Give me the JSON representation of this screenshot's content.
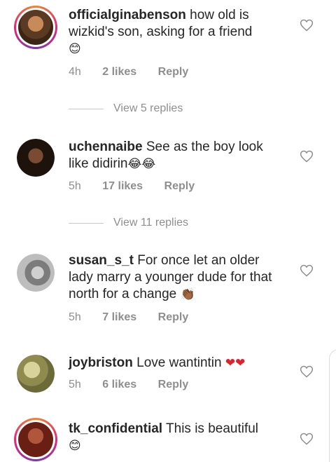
{
  "comments": [
    {
      "username": "officialginabenson",
      "text": "how old is wizkid's son, asking for a friend",
      "emoji": "😊",
      "time": "4h",
      "likes": "2 likes",
      "reply": "Reply",
      "avatar_color": "#6b4a2e",
      "has_story_ring": true
    },
    {
      "username": "uchennaibe",
      "text": "See as the boy look like didirin",
      "emoji": "😂😂",
      "time": "5h",
      "likes": "17 likes",
      "reply": "Reply",
      "avatar_color": "#2a1a14",
      "has_story_ring": false
    },
    {
      "username": "susan_s_t",
      "text": "For once let an older lady marry a younger dude for that north for a change",
      "emoji": "👏🏾",
      "time": "5h",
      "likes": "7 likes",
      "reply": "Reply",
      "avatar_color": "#9a9a9a",
      "has_story_ring": false
    },
    {
      "username": "joybriston",
      "text": "Love wantintin",
      "emoji": "❤❤",
      "time": "5h",
      "likes": "6 likes",
      "reply": "Reply",
      "avatar_color": "#a9a76a",
      "has_story_ring": false
    },
    {
      "username": "tk_confidential",
      "text": "This is beautiful",
      "emoji": "😊",
      "avatar_color": "#7a2a1a",
      "has_story_ring": true
    }
  ],
  "view_replies": [
    "View 5 replies",
    "View 11 replies"
  ],
  "colors": {
    "text": "#262626",
    "meta": "#8e8e8e",
    "heart_red": "#e0212b"
  },
  "icons": {
    "like": "heart-outline-icon"
  }
}
